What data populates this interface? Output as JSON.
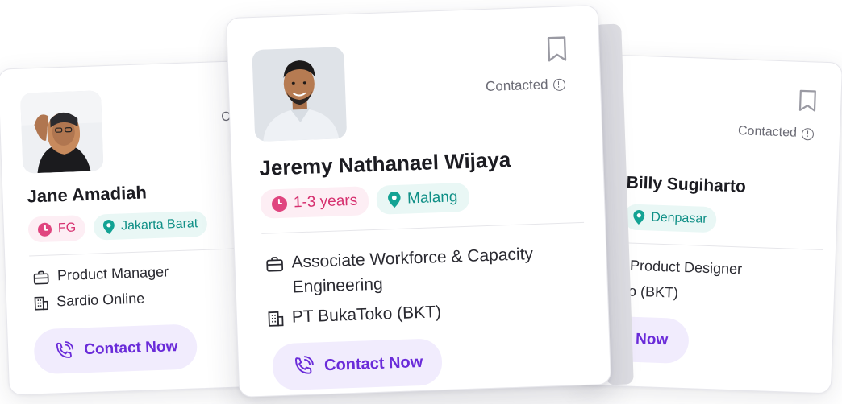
{
  "cards": {
    "left": {
      "name": "Jane Amadiah",
      "experience": "FG",
      "location": "Jakarta Barat",
      "status_partial": "C",
      "role": "Product Manager",
      "company": "Sardio Online",
      "cta": "Contact Now"
    },
    "main": {
      "name": "Jeremy Nathanael Wijaya",
      "experience": "1-3 years",
      "location": "Malang",
      "status": "Contacted",
      "role_line1": "Associate Workforce & Capacity",
      "role_line2": "Engineering",
      "company": "PT BukaToko (BKT)",
      "cta": "Contact Now"
    },
    "right": {
      "name": "Billy Sugiharto",
      "location": "Denpasar",
      "status": "Contacted",
      "role": "Product Designer",
      "company": "oko (BKT)",
      "cta": "ct Now"
    }
  },
  "icons": [
    "bookmark-icon",
    "info-icon",
    "clock-icon",
    "location-pin-icon",
    "briefcase-icon",
    "building-icon",
    "phone-call-icon"
  ],
  "colors": {
    "accent": "#6a2bd9",
    "cta_bg": "#f1ecfd",
    "experience_text": "#d6306f",
    "experience_bg": "#fdeef4",
    "location_text": "#0f8f86",
    "location_bg": "#e9f7f5"
  }
}
